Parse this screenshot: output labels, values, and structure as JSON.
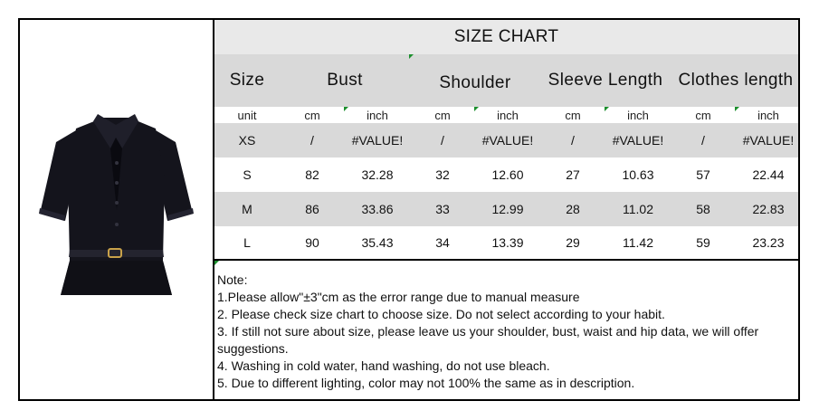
{
  "title": "SIZE CHART",
  "headers": [
    "Size",
    "Bust",
    "Shoulder",
    "Sleeve Length",
    "Clothes length"
  ],
  "units": [
    "unit",
    "cm",
    "inch",
    "cm",
    "inch",
    "cm",
    "inch",
    "cm",
    "inch"
  ],
  "rows": [
    [
      "XS",
      "/",
      "#VALUE!",
      "/",
      "#VALUE!",
      "/",
      "#VALUE!",
      "/",
      "#VALUE!"
    ],
    [
      "S",
      "82",
      "32.28",
      "32",
      "12.60",
      "27",
      "10.63",
      "57",
      "22.44"
    ],
    [
      "M",
      "86",
      "33.86",
      "33",
      "12.99",
      "28",
      "11.02",
      "58",
      "22.83"
    ],
    [
      "L",
      "90",
      "35.43",
      "34",
      "13.39",
      "29",
      "11.42",
      "59",
      "23.23"
    ]
  ],
  "notes": [
    "Note:",
    "1.Please allow\"±3\"cm as the error range due to manual measure",
    "2. Please check size chart to choose size. Do not select according to your habit.",
    "3. If still not sure about size, please leave us your shoulder, bust, waist and hip data, we will offer suggestions.",
    "4. Washing in cold water, hand washing, do not use bleach.",
    "5. Due to different lighting, color may not 100% the same as in description."
  ],
  "colors": {
    "title_bg": "#e9e9e9",
    "header_bg": "#d9d9d9",
    "row_gray": "#d9d9d9",
    "row_white": "#ffffff",
    "garment": "#14141c",
    "marker": "#1c8f2d"
  },
  "image": "black-short-sleeve-polo-top-with-belt"
}
